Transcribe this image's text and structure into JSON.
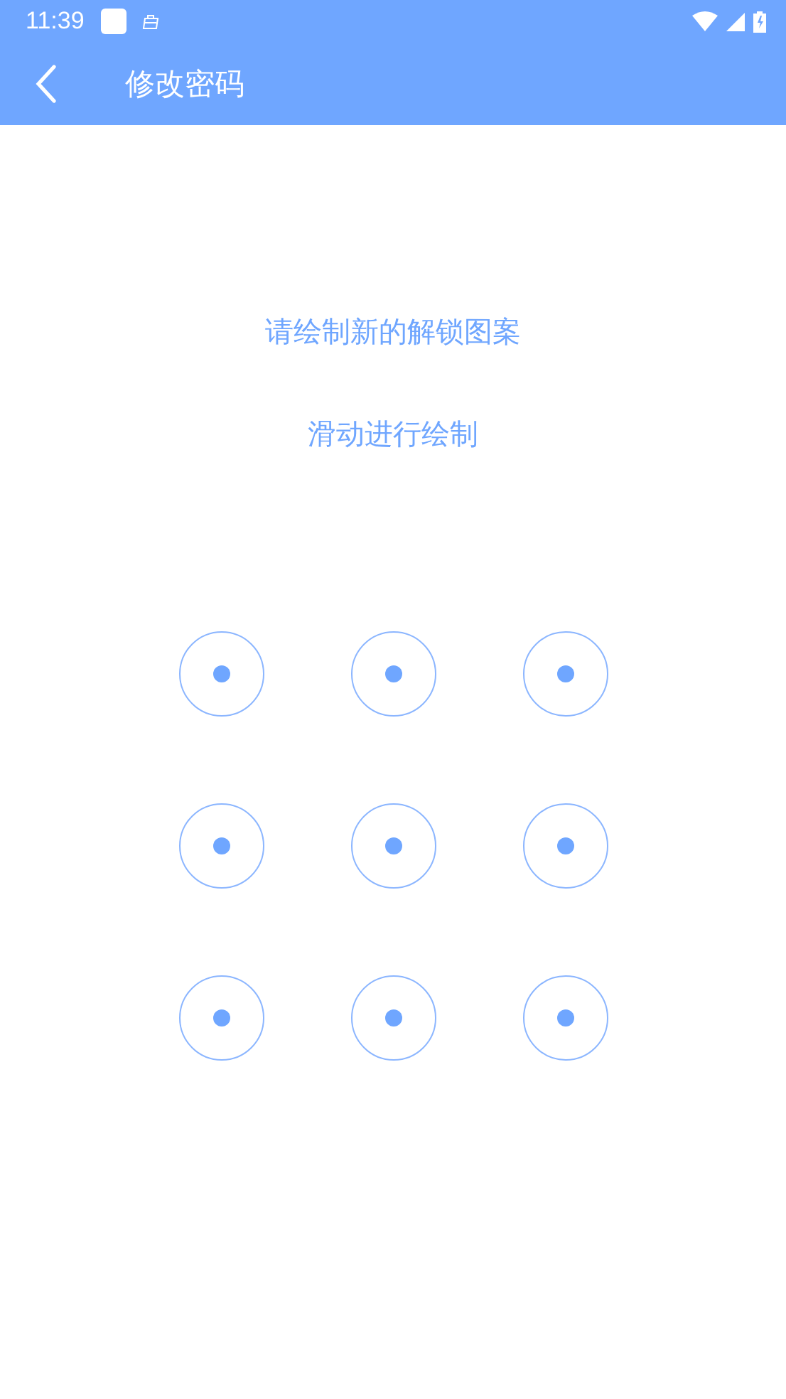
{
  "status_bar": {
    "time": "11:39"
  },
  "toolbar": {
    "title": "修改密码"
  },
  "prompt": "请绘制新的解锁图案",
  "hint": "滑动进行绘制",
  "pattern_nodes": [
    {
      "selected": false
    },
    {
      "selected": false
    },
    {
      "selected": false
    },
    {
      "selected": false
    },
    {
      "selected": false
    },
    {
      "selected": false
    },
    {
      "selected": false
    },
    {
      "selected": false
    },
    {
      "selected": false
    }
  ]
}
